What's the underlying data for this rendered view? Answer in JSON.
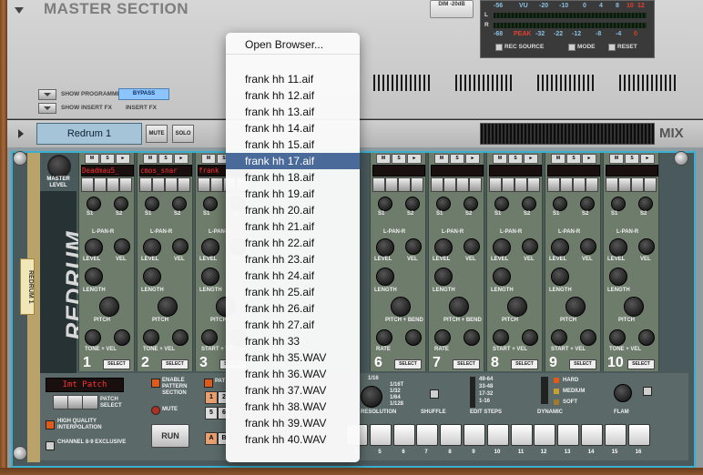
{
  "master": {
    "title": "MASTER SECTION",
    "dim_label": "DIM -20dB",
    "vu_label": "VU",
    "peak_label": "PEAK",
    "vu_scale": [
      "-56",
      "-20",
      "-10",
      "0",
      "4",
      "8",
      "10",
      "12"
    ],
    "peak_scale": [
      "-68",
      "-32",
      "-22",
      "-12",
      "-8",
      "-4",
      "0"
    ],
    "left_label": "L",
    "right_label": "R",
    "rec_source_label": "REC SOURCE",
    "mode_label": "MODE",
    "reset_label": "RESET",
    "show_programmer_label": "SHOW PROGRAMMER",
    "show_insert_fx_label": "SHOW INSERT FX",
    "bypass_label": "BYPASS",
    "insert_fx_label": "INSERT FX"
  },
  "strip": {
    "device_name": "Redrum 1",
    "mute_label": "MUTE",
    "solo_label": "SOLO",
    "mix_label": "MIX"
  },
  "redrum": {
    "master_level_label": "MASTER LEVEL",
    "logo": "REDRUM",
    "device_tag": "REDRUM 1",
    "mini_labels": [
      "M",
      "S",
      "►"
    ],
    "channels": [
      {
        "num": "1",
        "sample": "Deadmau5_"
      },
      {
        "num": "2",
        "sample": "cmos_snar"
      },
      {
        "num": "3",
        "sample": "frank"
      },
      {
        "num": "6",
        "sample": ""
      },
      {
        "num": "7",
        "sample": ""
      },
      {
        "num": "8",
        "sample": ""
      },
      {
        "num": "9",
        "sample": ""
      },
      {
        "num": "10",
        "sample": ""
      }
    ],
    "knob_labels": {
      "s1": "S1",
      "s2": "S2",
      "pan": "L-PAN-R",
      "level": "LEVEL",
      "vel": "VEL",
      "length": "LENGTH",
      "pitch": "PITCH",
      "pitch_bend": "PITCH + BEND",
      "tone_vel": "TONE + VEL",
      "start_vel": "START + VEL",
      "rate": "RATE",
      "select": "SELECT"
    },
    "pattern_display": "Imt Patch",
    "patch_select_label": "PATCH SELECT",
    "hq_label": "HIGH QUALITY INTERPOLATION",
    "ch89_label": "CHANNEL 8-9 EXCLUSIVE",
    "enable_pattern_label": "ENABLE PATTERN SECTION",
    "mute_label": "MUTE",
    "run_label": "RUN",
    "pattern_buttons": [
      "1",
      "2",
      "5",
      "6"
    ],
    "bank_buttons": [
      "A",
      "B"
    ],
    "pattern_short": "PAT",
    "resolution_label": "RESOLUTION",
    "resolution_options": [
      "1/16",
      "1/16T",
      "1/32",
      "1/64",
      "1/128"
    ],
    "shuffle_label": "SHUFFLE",
    "edit_steps_label": "EDIT STEPS",
    "edit_steps_options": [
      "49-64",
      "33-48",
      "17-32",
      "1-16"
    ],
    "dynamic_label": "DYNAMIC",
    "dynamic_options": [
      "HARD",
      "MEDIUM",
      "SOFT"
    ],
    "flam_label": "FLAM",
    "step_numbers": [
      "4",
      "5",
      "6",
      "7",
      "8",
      "9",
      "10",
      "11",
      "12",
      "13",
      "14",
      "15",
      "16"
    ]
  },
  "menu": {
    "open_browser": "Open Browser...",
    "items": [
      "frank hh 11.aif",
      "frank hh 12.aif",
      "frank hh 13.aif",
      "frank hh 14.aif",
      "frank hh 15.aif",
      "frank hh 17.aif",
      "frank hh 18.aif",
      "frank hh 19.aif",
      "frank hh 20.aif",
      "frank hh 21.aif",
      "frank hh 22.aif",
      "frank hh 23.aif",
      "frank hh 24.aif",
      "frank hh 25.aif",
      "frank hh 26.aif",
      "frank hh 27.aif",
      "frank hh 33",
      "frank hh 35.WAV",
      "frank hh 36.WAV",
      "frank hh 37.WAV",
      "frank hh 38.WAV",
      "frank hh 39.WAV",
      "frank hh 40.WAV"
    ],
    "selected_index": 5
  }
}
